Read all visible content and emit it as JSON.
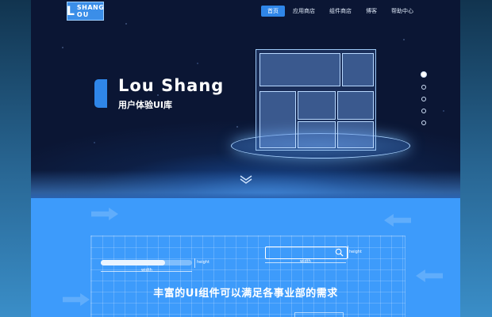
{
  "logo": {
    "top": "SHANG",
    "bottom": "OU",
    "mark": "L"
  },
  "nav": {
    "items": [
      {
        "label": "首页",
        "active": true
      },
      {
        "label": "应用商店"
      },
      {
        "label": "组件商店"
      },
      {
        "label": "博客"
      },
      {
        "label": "帮助中心"
      }
    ]
  },
  "hero": {
    "title": "Lou  Shang",
    "subtitle": "用户体验UI库",
    "slide_count": 5,
    "active_slide": 1
  },
  "feature": {
    "headline": "丰富的UI组件可以满足各事业部的需求",
    "progress_label_height": "height",
    "progress_label_width": "width",
    "search_label_height": "height",
    "search_label_width": "width",
    "progress_value": 0.7
  },
  "colors": {
    "accent": "#2f86e8",
    "section_blue": "#3d9bfb",
    "hero_dark": "#0d1f45"
  }
}
